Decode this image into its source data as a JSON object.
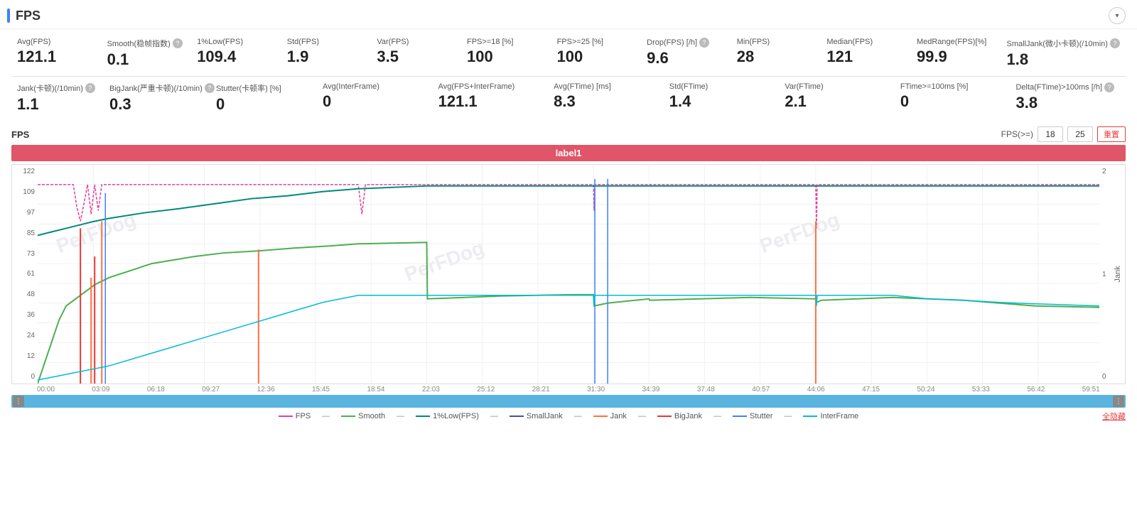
{
  "header": {
    "title": "FPS",
    "collapse_icon": "▾"
  },
  "stats_row1": [
    {
      "id": "avg-fps",
      "label": "Avg(FPS)",
      "value": "121.1",
      "help": false
    },
    {
      "id": "smooth",
      "label": "Smooth(稳帧指数)",
      "value": "0.1",
      "help": true
    },
    {
      "id": "low1pct",
      "label": "1%Low(FPS)",
      "value": "109.4",
      "help": false
    },
    {
      "id": "std",
      "label": "Std(FPS)",
      "value": "1.9",
      "help": false
    },
    {
      "id": "var",
      "label": "Var(FPS)",
      "value": "3.5",
      "help": false
    },
    {
      "id": "fps18",
      "label": "FPS>=18 [%]",
      "value": "100",
      "help": false
    },
    {
      "id": "fps25",
      "label": "FPS>=25 [%]",
      "value": "100",
      "help": false
    },
    {
      "id": "drop",
      "label": "Drop(FPS) [/h]",
      "value": "9.6",
      "help": true
    },
    {
      "id": "min",
      "label": "Min(FPS)",
      "value": "28",
      "help": false
    },
    {
      "id": "median",
      "label": "Median(FPS)",
      "value": "121",
      "help": false
    },
    {
      "id": "medrange",
      "label": "MedRange(FPS)[%]",
      "value": "99.9",
      "help": false
    },
    {
      "id": "smalljank",
      "label": "SmallJank(微小卡顿)(/10min)",
      "value": "1.8",
      "help": true
    }
  ],
  "stats_row2": [
    {
      "id": "jank",
      "label": "Jank(卡顿)(/10min)",
      "value": "1.1",
      "help": true
    },
    {
      "id": "bigjank",
      "label": "BigJank(严重卡顿)(/10min)",
      "value": "0.3",
      "help": true
    },
    {
      "id": "stutter",
      "label": "Stutter(卡顿率) [%]",
      "value": "0",
      "help": false
    },
    {
      "id": "avginterframe",
      "label": "Avg(InterFrame)",
      "value": "0",
      "help": false
    },
    {
      "id": "avgfpsinterframe",
      "label": "Avg(FPS+InterFrame)",
      "value": "121.1",
      "help": false
    },
    {
      "id": "avgftime",
      "label": "Avg(FTime) [ms]",
      "value": "8.3",
      "help": false
    },
    {
      "id": "stdftime",
      "label": "Std(FTime)",
      "value": "1.4",
      "help": false
    },
    {
      "id": "varftime",
      "label": "Var(FTime)",
      "value": "2.1",
      "help": false
    },
    {
      "id": "ftime100",
      "label": "FTime>=100ms [%]",
      "value": "0",
      "help": false
    },
    {
      "id": "deltaftime",
      "label": "Delta(FTime)>100ms [/h]",
      "value": "3.8",
      "help": true
    }
  ],
  "chart": {
    "title": "FPS",
    "label_bar": "label1",
    "fps_gte_label": "FPS(>=)",
    "fps_threshold1": "18",
    "fps_threshold2": "25",
    "reset_label": "重置",
    "y_axis_left": [
      "122",
      "109",
      "97",
      "85",
      "73",
      "61",
      "48",
      "36",
      "24",
      "12",
      "0"
    ],
    "y_axis_right": [
      "2",
      "",
      "1",
      "",
      "0"
    ],
    "jank_label": "Jank",
    "x_axis": [
      "00:00",
      "03:09",
      "06:18",
      "09:27",
      "12:36",
      "15:45",
      "18:54",
      "22:03",
      "25:12",
      "28:21",
      "31:30",
      "34:39",
      "37:48",
      "40:57",
      "44:06",
      "47:15",
      "50:24",
      "53:33",
      "56:42",
      "59:51"
    ]
  },
  "legend": {
    "items": [
      {
        "id": "fps",
        "label": "FPS",
        "color": "#e040a0",
        "style": "dashed"
      },
      {
        "id": "smooth",
        "label": "Smooth",
        "color": "#4caf50",
        "style": "solid"
      },
      {
        "id": "low1pct",
        "label": "1%Low(FPS)",
        "color": "#00897b",
        "style": "solid"
      },
      {
        "id": "smalljank",
        "label": "SmallJank",
        "color": "#3f51b5",
        "style": "solid"
      },
      {
        "id": "jank",
        "label": "Jank",
        "color": "#ff7043",
        "style": "solid"
      },
      {
        "id": "bigjank",
        "label": "BigJank",
        "color": "#e53935",
        "style": "solid"
      },
      {
        "id": "stutter",
        "label": "Stutter",
        "color": "#3b82f6",
        "style": "solid"
      },
      {
        "id": "interframe",
        "label": "InterFrame",
        "color": "#00bcd4",
        "style": "solid"
      }
    ],
    "hide_all_label": "全隐藏"
  }
}
